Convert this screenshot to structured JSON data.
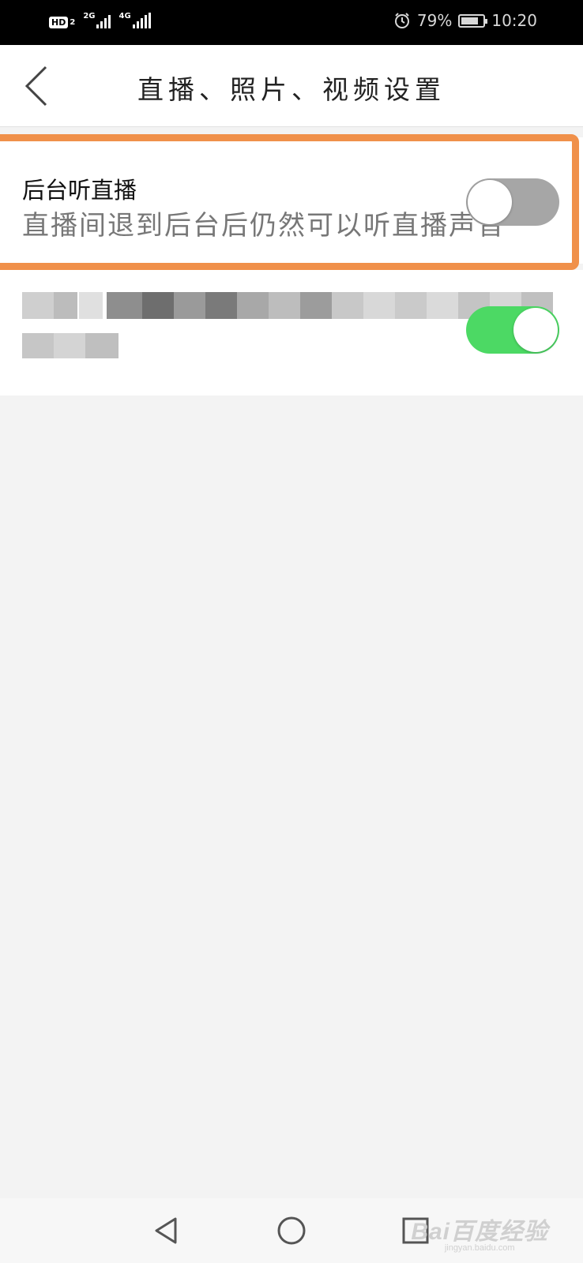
{
  "status_bar": {
    "hd_label": "HD",
    "sim_slot": "2",
    "net1_label": "2G",
    "net2_label": "4G",
    "alarm_icon": "alarm-clock-icon",
    "battery_percent_text": "79%",
    "battery_level": 0.79,
    "time": "10:20"
  },
  "header": {
    "back_icon": "chevron-left-icon",
    "title": "直播、照片、视频设置"
  },
  "settings": [
    {
      "title": "后台听直播",
      "description": "直播间退到后台后仍然可以听直播声音",
      "toggle_state": "off"
    },
    {
      "title": "",
      "description": "",
      "toggle_state": "on",
      "obscured": true
    }
  ],
  "colors": {
    "highlight": "#f0904a",
    "toggle_on": "#4cd964",
    "toggle_off": "#a6a6a6",
    "background": "#f3f3f3"
  },
  "nav_bar": {
    "back_icon": "triangle-back-icon",
    "home_icon": "circle-home-icon",
    "recents_icon": "square-recents-icon"
  },
  "watermark": {
    "brand": "Bai百度经验",
    "url": "jingyan.baidu.com"
  }
}
